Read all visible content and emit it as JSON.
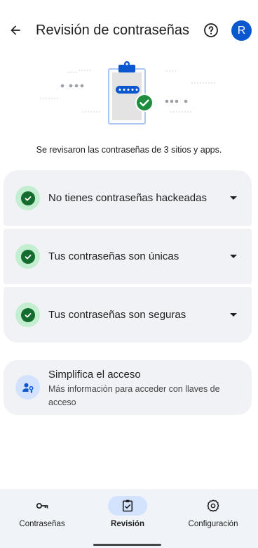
{
  "header": {
    "title": "Revisión de contraseñas",
    "back_icon": "arrow-back-icon",
    "help_icon": "help-circle-icon",
    "avatar_initial": "R"
  },
  "illustration": {
    "icon": "clipboard-password-check-illustration"
  },
  "summary": "Se revisaron las contraseñas de 3 sitios y apps.",
  "checks": [
    {
      "label": "No tienes contraseñas hackeadas",
      "icon": "check-circle-icon"
    },
    {
      "label": "Tus contraseñas son únicas",
      "icon": "check-circle-icon"
    },
    {
      "label": "Tus contraseñas son seguras",
      "icon": "check-circle-icon"
    }
  ],
  "passkey_card": {
    "title": "Simplifica el acceso",
    "description": "Más información para acceder con llaves de acceso",
    "icon": "person-key-icon"
  },
  "bottom_nav": [
    {
      "label": "Contraseñas",
      "icon": "key-icon",
      "active": false
    },
    {
      "label": "Revisión",
      "icon": "clipboard-check-icon",
      "active": true
    },
    {
      "label": "Configuración",
      "icon": "gear-icon",
      "active": false
    }
  ],
  "colors": {
    "accent": "#0b57d0",
    "success": "#146c2e",
    "success_container": "#c4eed0",
    "surface": "#f0f2f5",
    "nav_background": "#f0f4f9",
    "nav_active_pill": "#d3e3fd"
  }
}
